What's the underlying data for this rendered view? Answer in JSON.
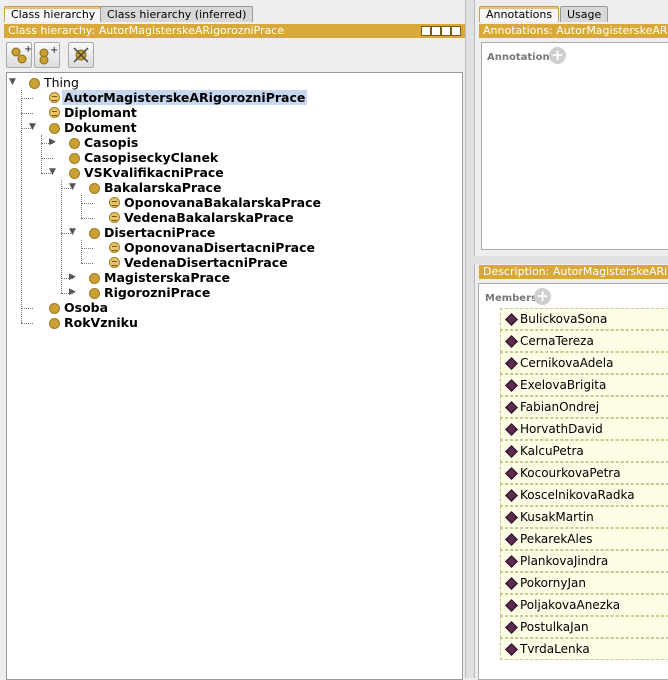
{
  "left": {
    "tabs": [
      {
        "label": "Class hierarchy",
        "active": true
      },
      {
        "label": "Class hierarchy (inferred)",
        "active": false
      }
    ],
    "title": "Class hierarchy: AutorMagisterskeARigorozniPrace",
    "toolbar": {
      "add_subclass_icon": "add-subclass-icon",
      "add_sibling_icon": "add-sibling-icon",
      "delete_icon": "delete-class-icon"
    },
    "tree": [
      {
        "label": "Thing",
        "level": 0,
        "expanded": true,
        "kind": "class",
        "bold": false
      },
      {
        "label": "AutorMagisterskeARigorozniPrace",
        "level": 1,
        "kind": "defined",
        "selected": true
      },
      {
        "label": "Diplomant",
        "level": 1,
        "kind": "defined"
      },
      {
        "label": "Dokument",
        "level": 1,
        "expanded": true,
        "kind": "class"
      },
      {
        "label": "Casopis",
        "level": 2,
        "expanded": false,
        "kind": "class"
      },
      {
        "label": "CasopiseckyClanek",
        "level": 2,
        "kind": "class"
      },
      {
        "label": "VSKvalifikacniPrace",
        "level": 2,
        "expanded": true,
        "kind": "class"
      },
      {
        "label": "BakalarskaPrace",
        "level": 3,
        "expanded": true,
        "kind": "class"
      },
      {
        "label": "OponovanaBakalarskaPrace",
        "level": 4,
        "kind": "defined"
      },
      {
        "label": "VedenaBakalarskaPrace",
        "level": 4,
        "kind": "defined"
      },
      {
        "label": "DisertacniPrace",
        "level": 3,
        "expanded": true,
        "kind": "class"
      },
      {
        "label": "OponovanaDisertacniPrace",
        "level": 4,
        "kind": "defined"
      },
      {
        "label": "VedenaDisertacniPrace",
        "level": 4,
        "kind": "defined"
      },
      {
        "label": "MagisterskaPrace",
        "level": 3,
        "expanded": false,
        "kind": "class"
      },
      {
        "label": "RigorozniPrace",
        "level": 3,
        "expanded": false,
        "kind": "class"
      },
      {
        "label": "Osoba",
        "level": 1,
        "kind": "class"
      },
      {
        "label": "RokVzniku",
        "level": 1,
        "kind": "class"
      }
    ]
  },
  "right": {
    "tabs": [
      {
        "label": "Annotations",
        "active": true
      },
      {
        "label": "Usage",
        "active": false
      }
    ],
    "annotations_title": "Annotations: AutorMagisterskeARigorozniPrace",
    "annotations_label": "Annotations",
    "description_title": "Description: AutorMagisterskeARigorozniPrace",
    "members_label": "Members",
    "members": [
      "BulickovaSona",
      "CernaTereza",
      "CernikovaAdela",
      "ExelovaBrigita",
      "FabianOndrej",
      "HorvathDavid",
      "KalcuPetra",
      "KocourkovaPetra",
      "KoscelnikovaRadka",
      "KusakMartin",
      "PekarekAles",
      "PlankovaJindra",
      "PokornyJan",
      "PoljakovaAnezka",
      "PostulkaJan",
      "TvrdaLenka"
    ]
  },
  "colors": {
    "accent": "#d8a93a",
    "class": "#c9a034",
    "selection": "#c7d7ee",
    "member_bg": "#fdfde6"
  }
}
